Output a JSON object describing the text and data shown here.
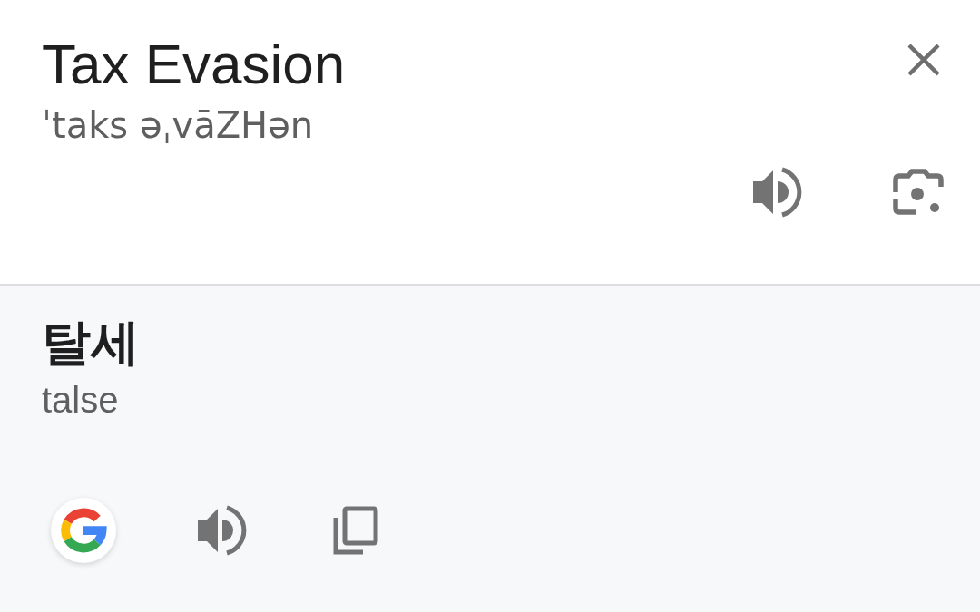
{
  "source": {
    "text": "Tax Evasion",
    "pronunciation": "ˈtaks əˌvāZHən"
  },
  "translation": {
    "text": "탈세",
    "romanization": "talse"
  }
}
